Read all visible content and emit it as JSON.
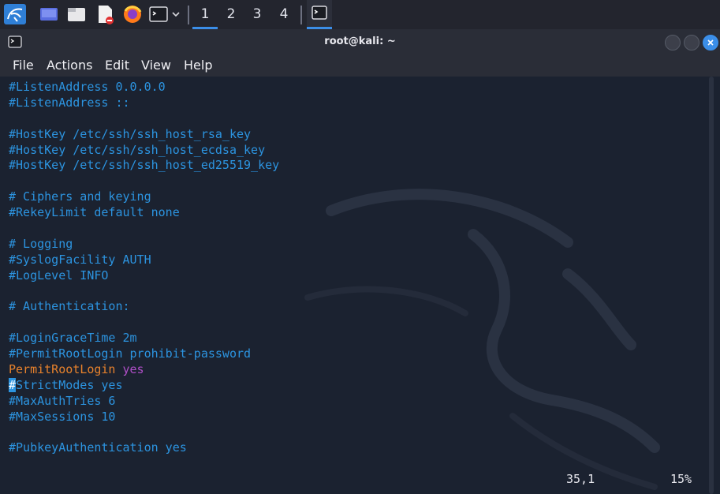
{
  "taskbar": {
    "workspaces": [
      "1",
      "2",
      "3",
      "4"
    ],
    "active_workspace": "1",
    "icons": [
      "kali-menu-icon",
      "desktop-icon",
      "file-manager-icon",
      "text-editor-icon",
      "firefox-icon",
      "terminal-icon",
      "chevron-down-icon"
    ]
  },
  "window": {
    "title": "root@kali: ~",
    "menu": [
      "File",
      "Actions",
      "Edit",
      "View",
      "Help"
    ]
  },
  "editor": {
    "lines": [
      {
        "text": "#ListenAddress 0.0.0.0"
      },
      {
        "text": "#ListenAddress ::"
      },
      {
        "text": ""
      },
      {
        "text": "#HostKey /etc/ssh/ssh_host_rsa_key"
      },
      {
        "text": "#HostKey /etc/ssh/ssh_host_ecdsa_key"
      },
      {
        "text": "#HostKey /etc/ssh/ssh_host_ed25519_key"
      },
      {
        "text": ""
      },
      {
        "text": "# Ciphers and keying"
      },
      {
        "text": "#RekeyLimit default none"
      },
      {
        "text": ""
      },
      {
        "text": "# Logging"
      },
      {
        "text": "#SyslogFacility AUTH"
      },
      {
        "text": "#LogLevel INFO"
      },
      {
        "text": ""
      },
      {
        "text": "# Authentication:"
      },
      {
        "text": ""
      },
      {
        "text": "#LoginGraceTime 2m"
      },
      {
        "text": "#PermitRootLogin prohibit-password"
      },
      {
        "keyword": "PermitRootLogin",
        "value": "yes"
      },
      {
        "cursor_char": "#",
        "text": "StrictModes yes"
      },
      {
        "text": "#MaxAuthTries 6"
      },
      {
        "text": "#MaxSessions 10"
      },
      {
        "text": ""
      },
      {
        "text": "#PubkeyAuthentication yes"
      }
    ],
    "cursor_position": "35,1",
    "scroll_percent": "15%"
  },
  "colors": {
    "comment": "#2c94e0",
    "keyword": "#e8822c",
    "value": "#b04fc8",
    "background": "#1b2230",
    "accent": "#3b8ee8"
  }
}
